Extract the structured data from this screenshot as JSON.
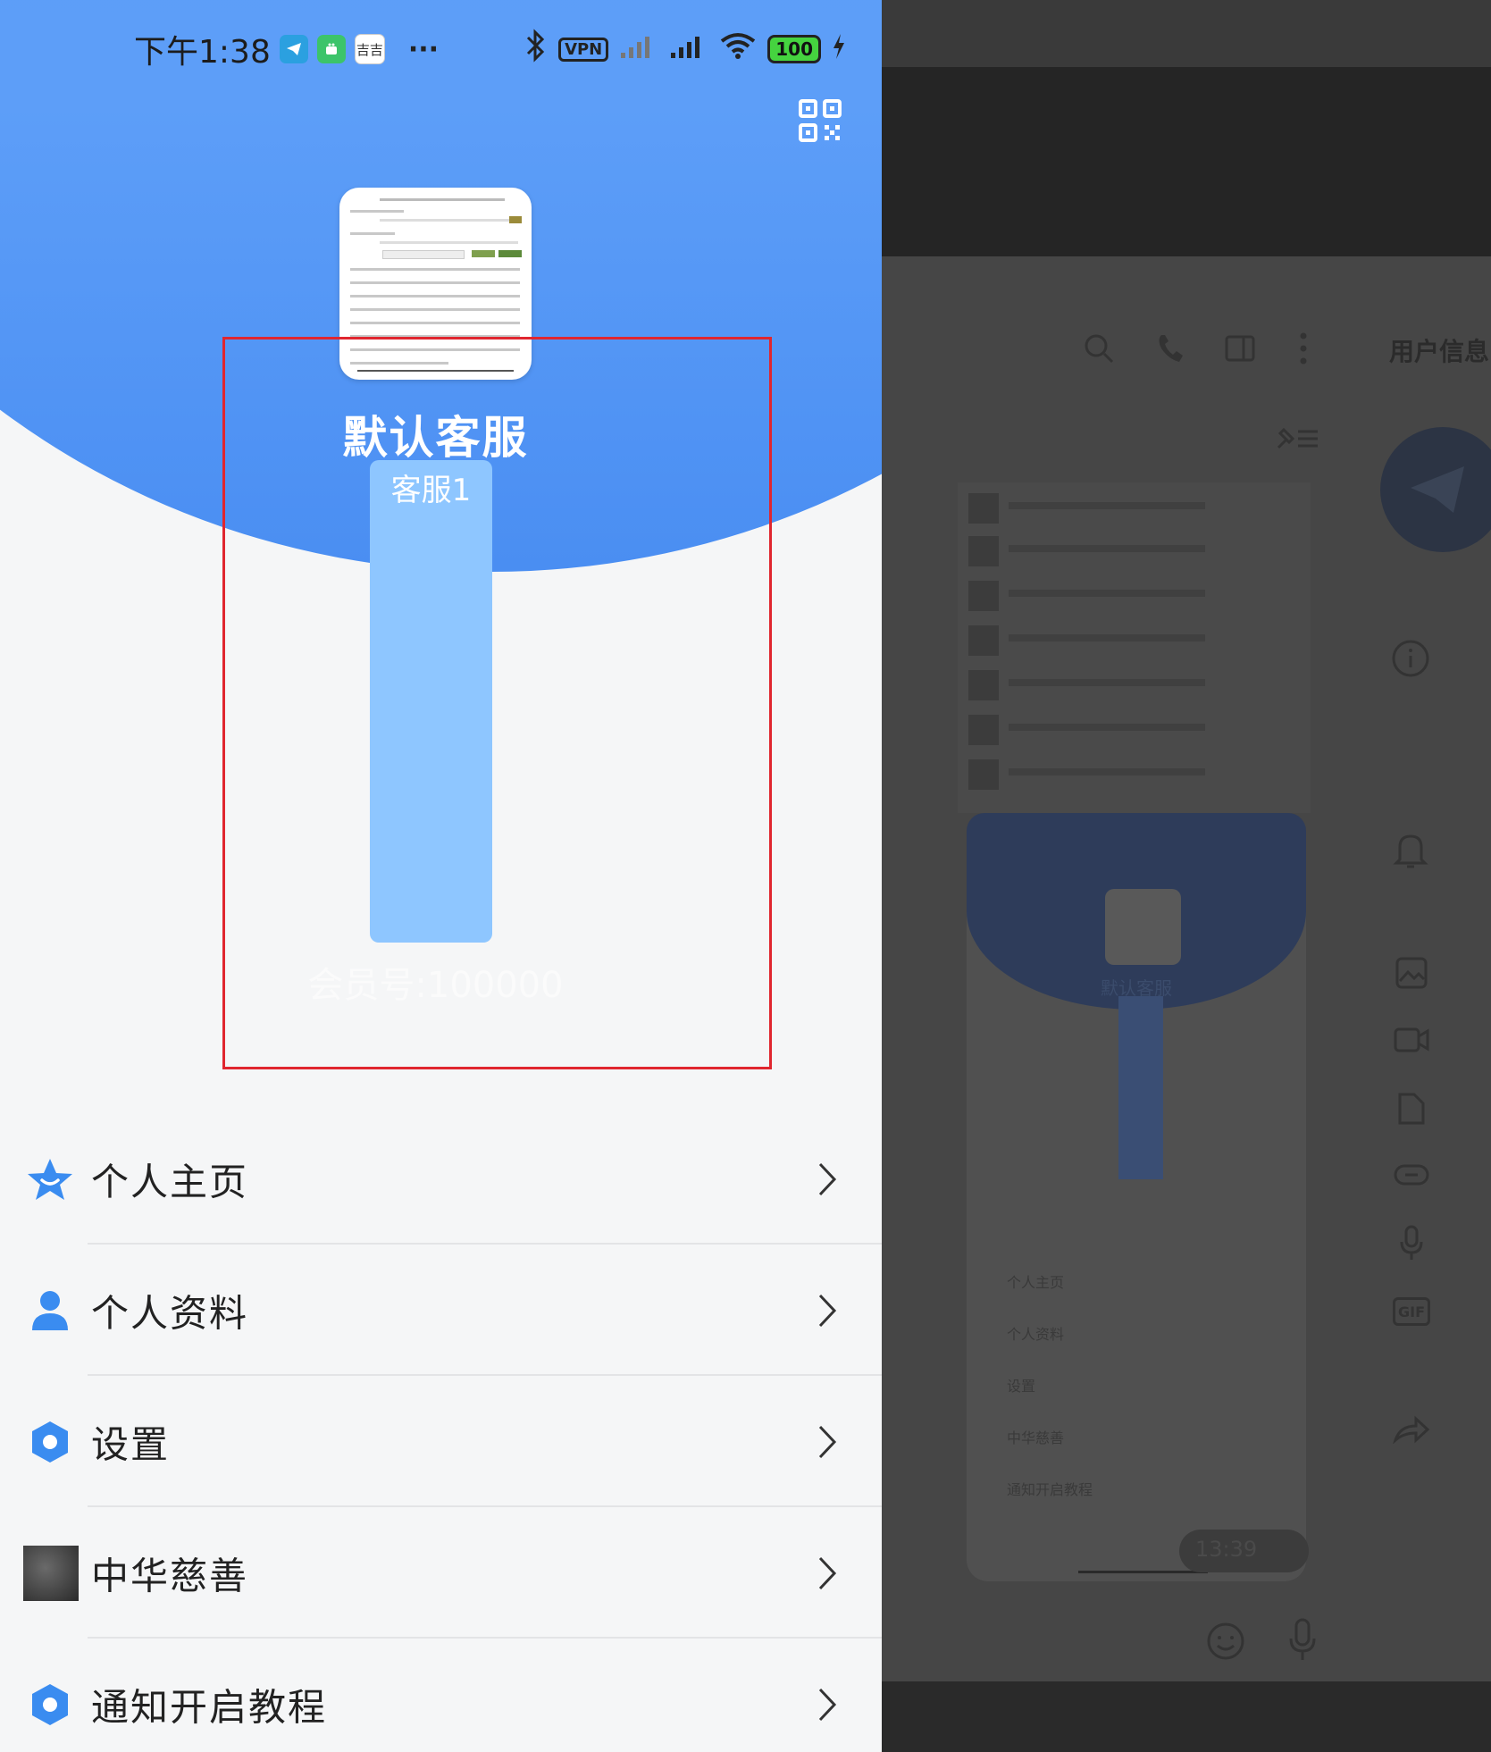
{
  "status_bar": {
    "time": "下午1:38",
    "app_icon_3_label": "吉吉",
    "more": "···",
    "vpn_label": "VPN",
    "battery_label": "100"
  },
  "profile": {
    "display_name": "默认客服",
    "bio": "客服1",
    "member_id": "会员号:100000"
  },
  "menu": [
    {
      "label": "个人主页",
      "icon": "star-badge-icon"
    },
    {
      "label": "个人资料",
      "icon": "person-icon"
    },
    {
      "label": "设置",
      "icon": "hexagon-settings-icon"
    },
    {
      "label": "中华慈善",
      "icon": "photo-thumbnail"
    },
    {
      "label": "通知开启教程",
      "icon": "hexagon-settings-icon"
    }
  ],
  "background_app": {
    "panel_title": "用户信息",
    "gif_label": "GIF",
    "mini_time": "13:39",
    "mini_menu": [
      "个人主页",
      "个人资料",
      "设置",
      "中华慈善",
      "通知开启教程"
    ],
    "mini_name": "默认客服"
  },
  "colors": {
    "header_blue": "#5d9ef8",
    "bio_block": "#8ec6ff",
    "icon_blue": "#3a8cf0",
    "highlight_red": "#e0262f"
  }
}
